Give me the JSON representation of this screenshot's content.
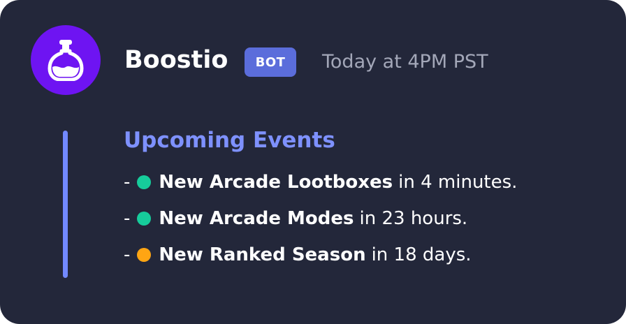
{
  "message": {
    "username": "Boostio",
    "badge": "BOT",
    "timestamp": "Today at 4PM PST",
    "avatar_icon": "potion-bottle-icon",
    "colors": {
      "background": "#23273a",
      "avatar": "#6e14f2",
      "badge": "#5b6ddb",
      "accent": "#7e91ff"
    }
  },
  "embed": {
    "title": "Upcoming Events",
    "events": [
      {
        "dash": "-",
        "status_color": "#16cc9b",
        "name": "New Arcade Lootboxes",
        "time": "in 4 minutes."
      },
      {
        "dash": "-",
        "status_color": "#16cc9b",
        "name": "New Arcade Modes",
        "time": "in 23 hours."
      },
      {
        "dash": "-",
        "status_color": "#ffa513",
        "name": "New Ranked Season",
        "time": "in 18 days."
      }
    ]
  }
}
